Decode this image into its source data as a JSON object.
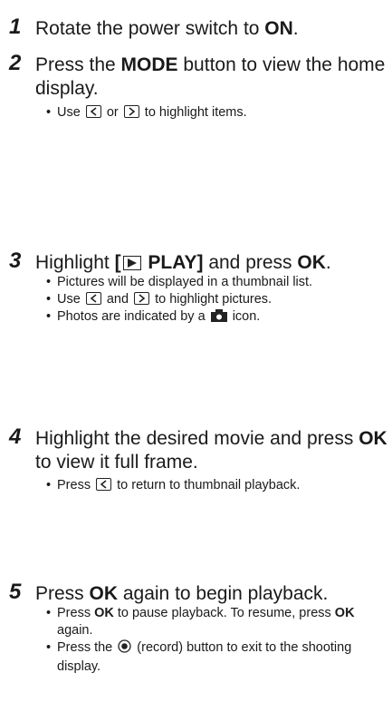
{
  "steps": [
    {
      "num": "1",
      "t1": "Rotate the power switch to ",
      "t1b": "ON",
      "t1c": "."
    },
    {
      "num": "2",
      "t1": "Press the ",
      "t1b": "MODE",
      "t1c": " button to view the home display.",
      "b1a": "Use ",
      "b1b": " or ",
      "b1c": " to highlight items."
    },
    {
      "num": "3",
      "t1": "Highlight ",
      "t1b": "[",
      "t1b2": " PLAY]",
      "t1c": " and press ",
      "t1d": "OK",
      "t1e": ".",
      "b1": "Pictures will be displayed in a thumbnail list.",
      "b2a": "Use ",
      "b2b": " and ",
      "b2c": " to highlight pictures.",
      "b3a": "Photos are indicated by a ",
      "b3b": " icon."
    },
    {
      "num": "4",
      "t1": "Highlight the desired movie and press ",
      "t1b": "OK",
      "t1c": " to view it full frame.",
      "b1a": "Press ",
      "b1b": " to return to thumbnail playback."
    },
    {
      "num": "5",
      "t1": "Press ",
      "t1b": "OK",
      "t1c": " again to begin playback.",
      "b1a": "Press ",
      "b1b": "OK",
      "b1c": " to pause playback. To resume, press ",
      "b1d": "OK",
      "b1e": " again.",
      "b2a": "Press the ",
      "b2b": " (record) button to exit to the shooting display."
    }
  ],
  "icons": {
    "left_key": "left-arrow-key-icon",
    "right_key": "right-arrow-key-icon",
    "play": "play-icon",
    "camera": "camera-icon",
    "record": "record-button-icon"
  }
}
